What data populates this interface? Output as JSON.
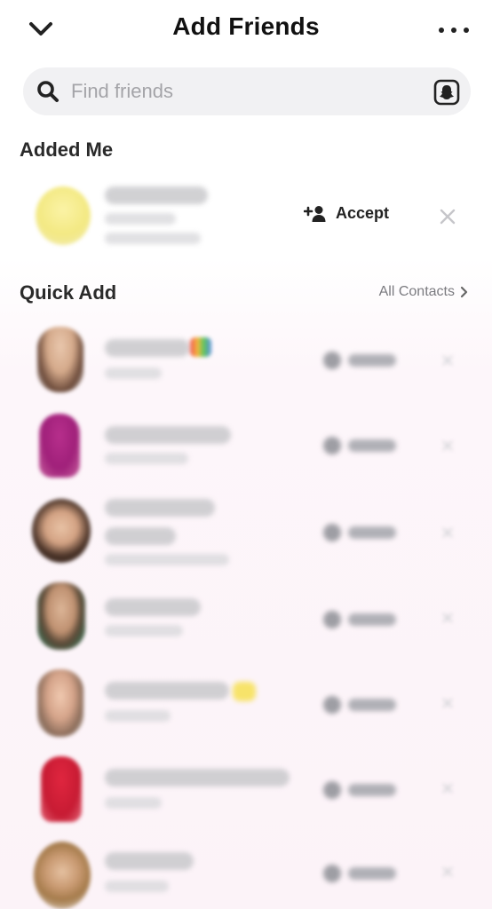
{
  "header": {
    "title": "Add Friends",
    "back_icon": "chevron-down-icon",
    "more_icon": "more-horizontal-icon"
  },
  "search": {
    "placeholder": "Find friends",
    "search_icon": "search-icon",
    "scan_icon": "snapcode-scan-icon"
  },
  "added_me": {
    "heading": "Added Me",
    "accept_label": "Accept",
    "accept_icon": "add-friend-icon",
    "dismiss_icon": "close-icon"
  },
  "quick_add": {
    "heading": "Quick Add",
    "all_contacts_label": "All Contacts",
    "all_contacts_icon": "chevron-right-icon"
  },
  "colors": {
    "background": "#ffffff",
    "search_background": "#f1f1f3",
    "text_primary": "#1a1a1a",
    "text_secondary": "#7b7b80"
  }
}
